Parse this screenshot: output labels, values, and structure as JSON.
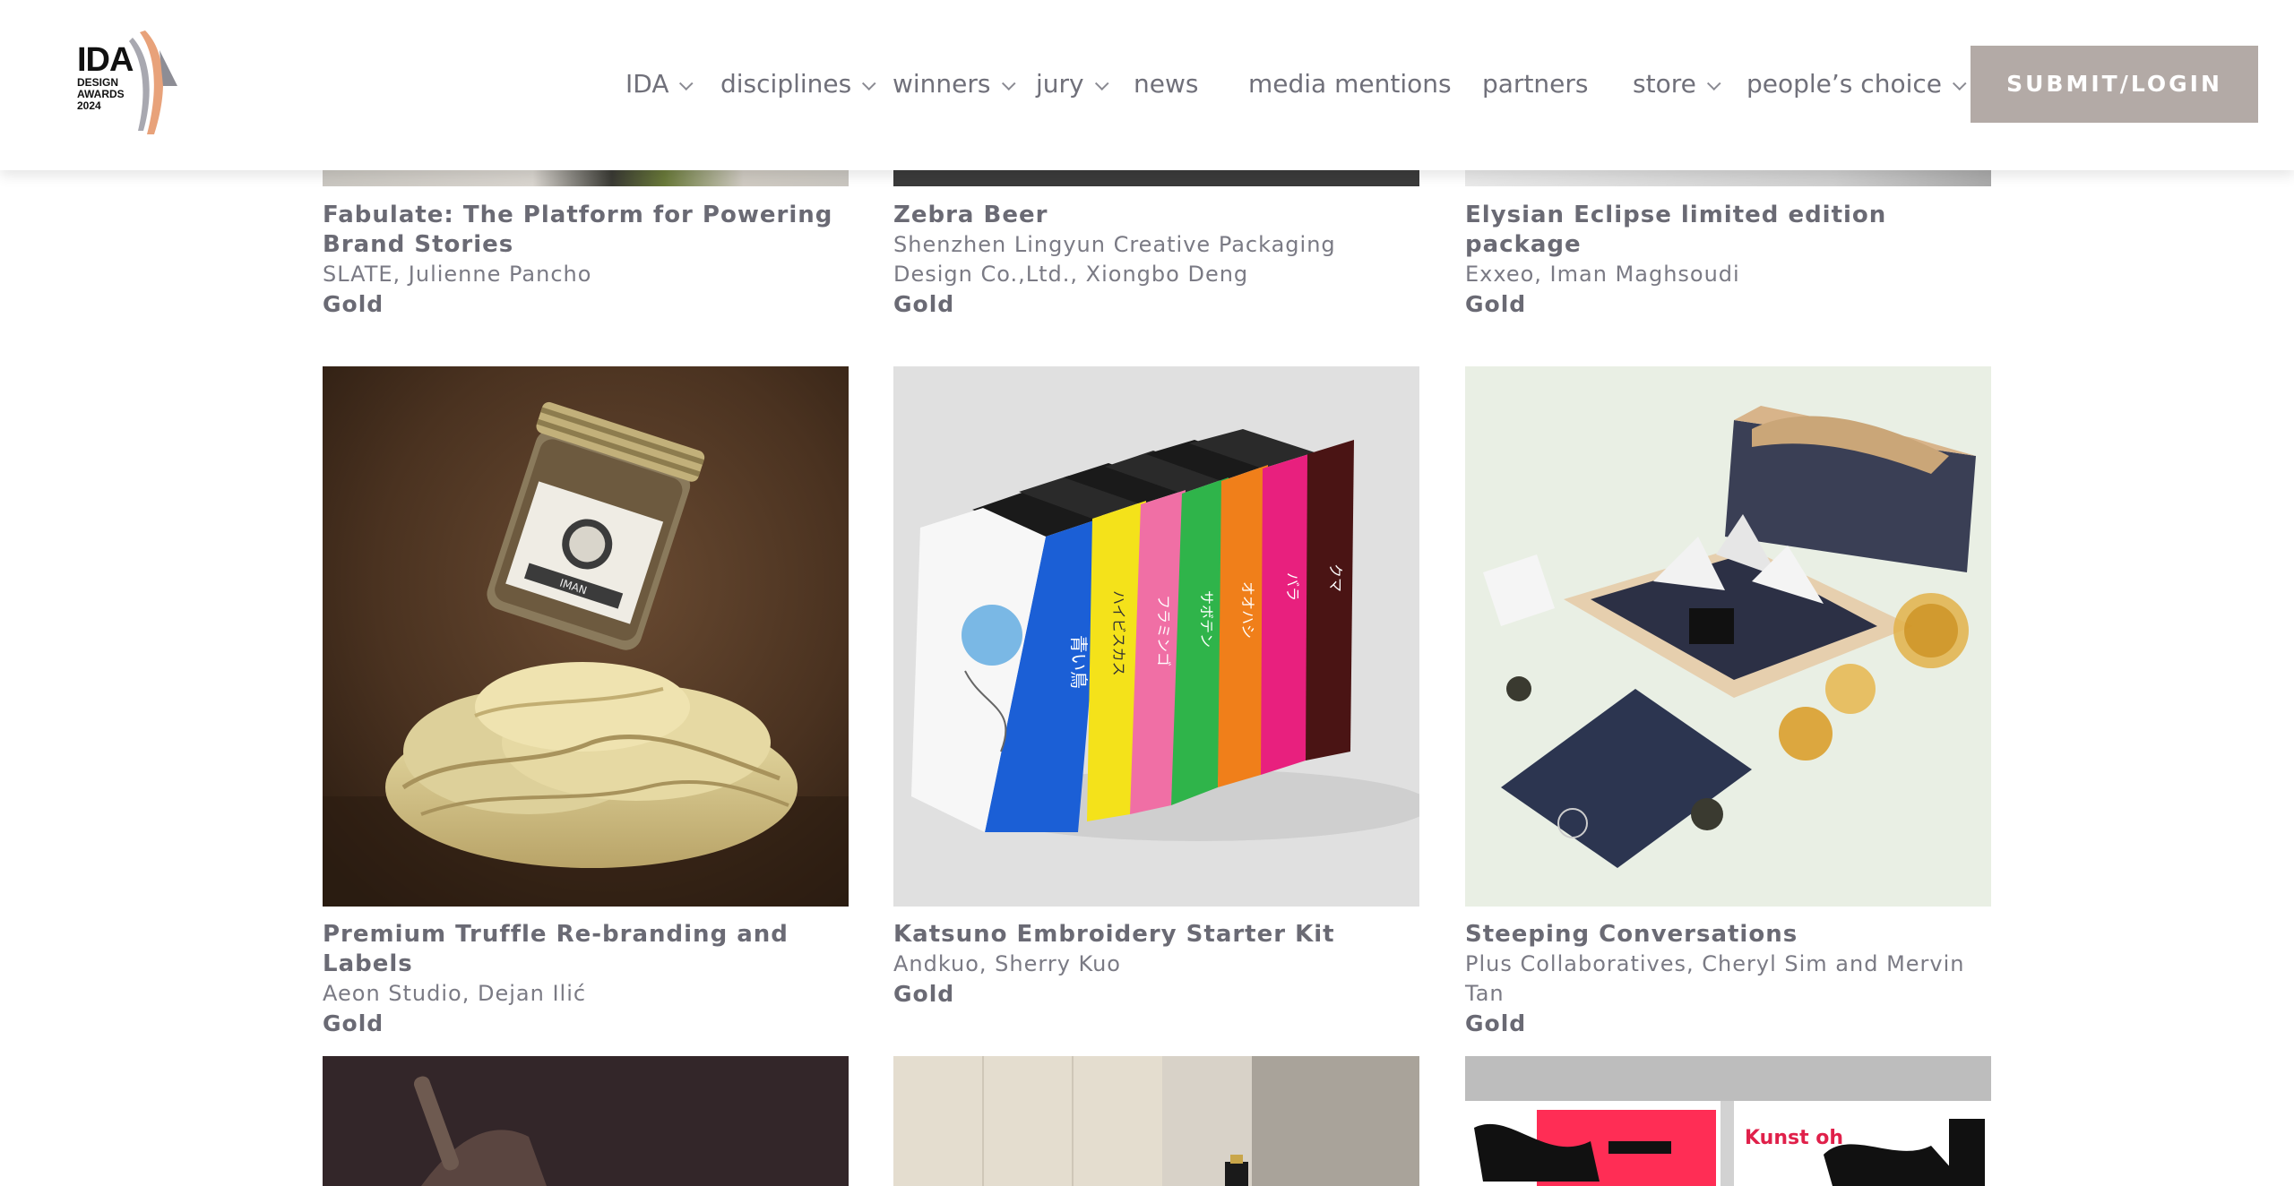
{
  "brand": {
    "logo_title": "IDA",
    "logo_lines": [
      "DESIGN",
      "AWARDS",
      "2024"
    ]
  },
  "nav": {
    "items": [
      {
        "label": "IDA",
        "has_dropdown": true
      },
      {
        "label": "disciplines",
        "has_dropdown": true
      },
      {
        "label": "winners",
        "has_dropdown": true
      },
      {
        "label": "jury",
        "has_dropdown": true
      },
      {
        "label": "news",
        "has_dropdown": false
      },
      {
        "label": "media mentions",
        "has_dropdown": false
      },
      {
        "label": "partners",
        "has_dropdown": false
      },
      {
        "label": "store",
        "has_dropdown": true
      },
      {
        "label": "people’s choice",
        "has_dropdown": true
      }
    ],
    "submit_label": "SUBMIT/LOGIN"
  },
  "entries_top": [
    {
      "title": "Fabulate: The Platform for Powering Brand Stories",
      "author": "SLATE, Julienne Pancho",
      "award": "Gold"
    },
    {
      "title": "Zebra Beer",
      "author": "Shenzhen Lingyun Creative Packaging Design Co.,Ltd., Xiongbo Deng",
      "award": "Gold"
    },
    {
      "title": "Elysian Eclipse limited edition package",
      "author": "Exxeo, Iman Maghsoudi",
      "award": "Gold"
    }
  ],
  "entries_middle": [
    {
      "title": "Premium Truffle Re-branding and Labels",
      "author": "Aeon Studio, Dejan Ilić",
      "award": "Gold"
    },
    {
      "title": "Katsuno Embroidery Starter Kit",
      "author": "Andkuo, Sherry Kuo",
      "award": "Gold"
    },
    {
      "title": "Steeping Conversations",
      "author": "Plus Collaboratives, Cheryl Sim and Mervin Tan",
      "award": "Gold"
    }
  ],
  "image_texts": {
    "jar_label": "IMAN",
    "book_spines": [
      "青い鳥",
      "ハイビスカス",
      "フラミンゴ",
      "サボテン",
      "オオハシ",
      "バラ",
      "クマ"
    ],
    "poster_text": "Kunst oh"
  },
  "colors": {
    "submit_bg": "#b3aaa6",
    "text": "#6f6f7a",
    "logo_accent": "#e8a27a"
  }
}
